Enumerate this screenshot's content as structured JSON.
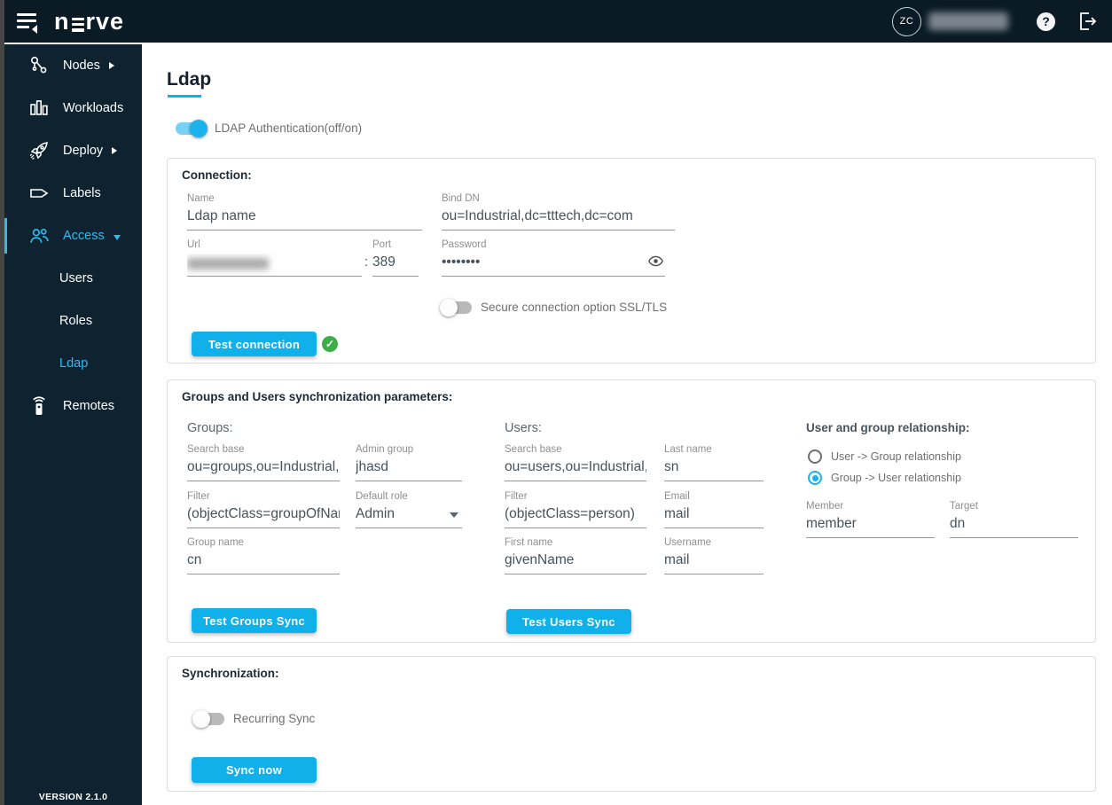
{
  "topbar": {
    "logo_prefix": "n",
    "logo_suffix": "rve",
    "avatar_initials": "ZC"
  },
  "sidebar": {
    "items": [
      {
        "label": "Nodes"
      },
      {
        "label": "Workloads"
      },
      {
        "label": "Deploy"
      },
      {
        "label": "Labels"
      },
      {
        "label": "Access"
      },
      {
        "label": "Remotes"
      }
    ],
    "subitems": [
      {
        "label": "Users"
      },
      {
        "label": "Roles"
      },
      {
        "label": "Ldap"
      }
    ],
    "version": "VERSION 2.1.0"
  },
  "main": {
    "title": "Ldap",
    "ldap_toggle_label": "LDAP Authentication(off/on)",
    "connection": {
      "title": "Connection:",
      "name": {
        "label": "Name",
        "value": "Ldap name"
      },
      "bind_dn": {
        "label": "Bind DN",
        "value": "ou=Industrial,dc=tttech,dc=com"
      },
      "url": {
        "label": "Url",
        "value": ""
      },
      "port": {
        "label": "Port",
        "separator": ":",
        "value": "389"
      },
      "password": {
        "label": "Password",
        "value": "••••••••"
      },
      "secure_toggle_label": "Secure connection option SSL/TLS",
      "test_button": "Test connection",
      "test_success_icon": "✓"
    },
    "sync_params": {
      "title": "Groups and Users synchronization parameters:",
      "groups": {
        "title": "Groups:",
        "search_base": {
          "label": "Search base",
          "value": "ou=groups,ou=Industrial,"
        },
        "admin_group": {
          "label": "Admin group",
          "value": "jhasd"
        },
        "filter": {
          "label": "Filter",
          "value": "(objectClass=groupOfNar"
        },
        "default_role": {
          "label": "Default role",
          "value": "Admin"
        },
        "group_name": {
          "label": "Group name",
          "value": "cn"
        },
        "test_button": "Test Groups Sync"
      },
      "users": {
        "title": "Users:",
        "search_base": {
          "label": "Search base",
          "value": "ou=users,ou=Industrial,"
        },
        "last_name": {
          "label": "Last name",
          "value": "sn"
        },
        "filter": {
          "label": "Filter",
          "value": "(objectClass=person)"
        },
        "email": {
          "label": "Email",
          "value": "mail"
        },
        "first_name": {
          "label": "First name",
          "value": "givenName"
        },
        "username": {
          "label": "Username",
          "value": "mail"
        },
        "test_button": "Test Users Sync"
      },
      "relationship": {
        "title": "User and group relationship:",
        "options": [
          {
            "label": "User -> Group relationship",
            "selected": false
          },
          {
            "label": "Group -> User relationship",
            "selected": true
          }
        ],
        "member": {
          "label": "Member",
          "value": "member"
        },
        "target": {
          "label": "Target",
          "value": "dn"
        }
      }
    },
    "synchronization": {
      "title": "Synchronization:",
      "recurring_label": "Recurring Sync",
      "sync_button": "Sync now"
    }
  },
  "colors": {
    "accent": "#29bdf2",
    "button": "#10b1eb",
    "success": "#3dad4a",
    "topbar": "#0a1b26",
    "sidebar": "#0e2230"
  }
}
